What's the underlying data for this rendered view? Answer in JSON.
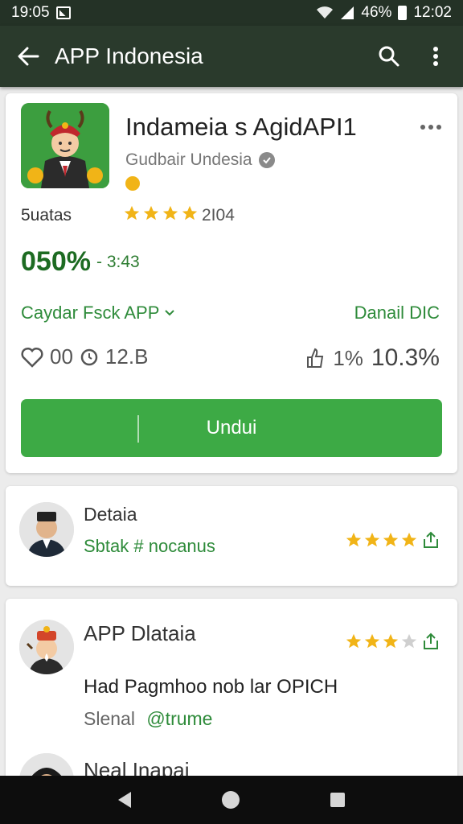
{
  "status_bar": {
    "time_left": "19:05",
    "battery_percent": "46%",
    "time_right": "12:02"
  },
  "app_bar": {
    "title": "APP Indonesia",
    "icons": [
      "back-arrow-icon",
      "search-icon",
      "overflow-menu-icon"
    ]
  },
  "app_card": {
    "name": "Indameia s AgidAPI1",
    "developer": "Gudbair Undesia",
    "rating_label": "5uatas",
    "rating_stars": 4,
    "rating_count": "2I04",
    "percent_main": "050%",
    "percent_sub": "- 3:43",
    "category": "Caydar Fsck APP",
    "detail": "Danail DIC",
    "stat_1": "00",
    "stat_2": "12.B",
    "stat_3": "1%",
    "stat_4": "10.3%",
    "download_label": "Undui"
  },
  "reviews": [
    {
      "author": "Detaia",
      "subtitle": "Sbtak # nocanus",
      "stars": 4,
      "total_stars": 4
    },
    {
      "author": "APP Dlataia",
      "text": "Had Pagmhoo nob lar OPICH",
      "subtitle_prefix": "Slenal",
      "subtitle_suffix": "@trume",
      "stars": 3,
      "total_stars": 4
    },
    {
      "author": "Neal Inapai"
    }
  ],
  "colors": {
    "app_bar": "#2a3a2c",
    "accent_green": "#3daa45",
    "dark_green_text": "#1d6b22",
    "star": "#f1b417"
  }
}
